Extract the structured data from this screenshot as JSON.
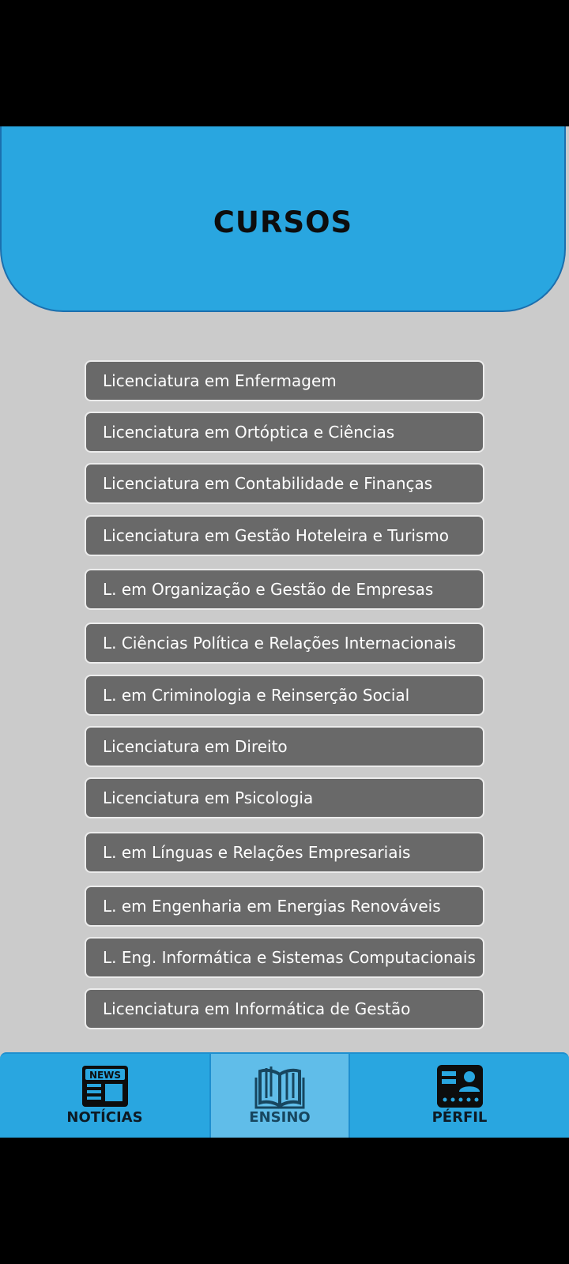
{
  "header": {
    "title": "CURSOS"
  },
  "courses": [
    "Licenciatura em Enfermagem",
    "Licenciatura em Ortóptica e Ciências",
    "Licenciatura em Contabilidade e Finanças",
    "Licenciatura em Gestão Hoteleira e Turismo",
    "L. em Organização e Gestão de Empresas",
    "L. Ciências Política e Relações Internacionais",
    "L. em Criminologia e Reinserção Social",
    "Licenciatura em Direito",
    "Licenciatura em Psicologia",
    "L. em Línguas e Relações Empresariais",
    "L. em Engenharia em Energias Renováveis",
    "L. Eng. Informática e Sistemas Computacionais",
    "Licenciatura em Informática de Gestão"
  ],
  "tabs": {
    "news": {
      "label": "NOTÍCIAS",
      "icon": "newspaper-icon",
      "icon_text": "NEWS"
    },
    "teaching": {
      "label": "ENSINO",
      "icon": "book-icon",
      "active": true
    },
    "profile": {
      "label": "PÉRFIL",
      "icon": "id-card-icon"
    }
  },
  "colors": {
    "accent": "#29a6e0",
    "active_tab": "#60bde9",
    "course_bg": "#696969",
    "screen_bg": "#cbcbcb"
  }
}
